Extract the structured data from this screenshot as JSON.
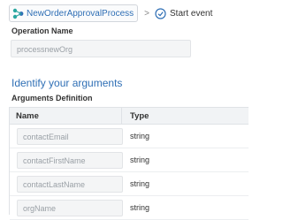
{
  "breadcrumb": {
    "process_label": "NewOrderApprovalProcess",
    "separator": ">",
    "current_label": "Start event",
    "process_icon": "process-flow-icon",
    "event_icon": "start-event-icon"
  },
  "operation": {
    "label": "Operation Name",
    "value": "processnewOrg"
  },
  "arguments": {
    "section_title": "Identify your arguments",
    "definition_label": "Arguments Definition",
    "columns": [
      "Name",
      "Type"
    ],
    "rows": [
      {
        "name": "contactEmail",
        "type": "string"
      },
      {
        "name": "contactFirstName",
        "type": "string"
      },
      {
        "name": "contactLastName",
        "type": "string"
      },
      {
        "name": "orgName",
        "type": "string"
      }
    ]
  },
  "colors": {
    "link": "#2f6fb5",
    "process_icon_teal": "#2aa7a0",
    "process_icon_blue": "#2f6fb5"
  }
}
